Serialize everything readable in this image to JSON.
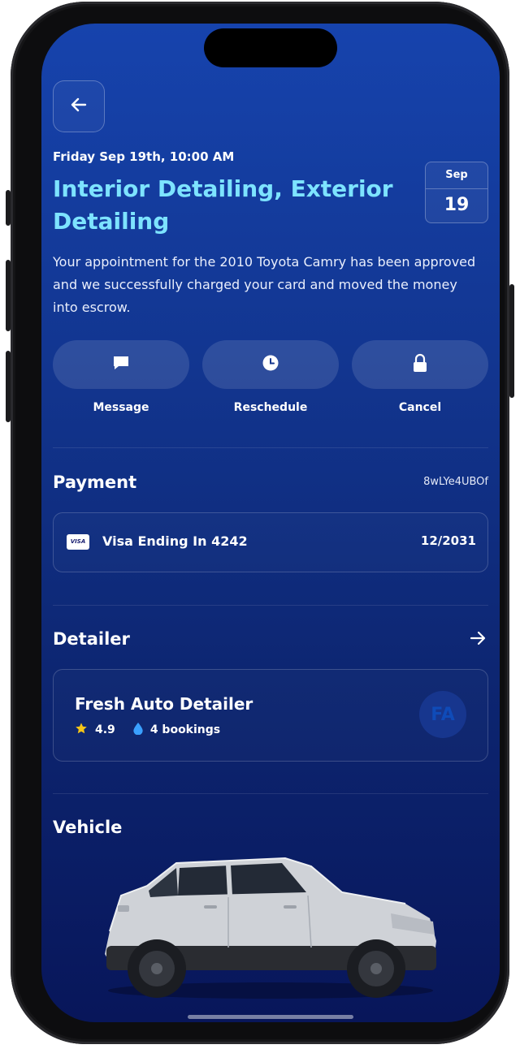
{
  "appointment": {
    "datetime": "Friday Sep 19th, 10:00 AM",
    "title": "Interior Detailing, Exterior Detailing",
    "calendar_month": "Sep",
    "calendar_day": "19",
    "description": "Your appointment for the 2010 Toyota Camry has been approved and we successfully charged your card and moved the money into escrow."
  },
  "actions": [
    {
      "label": "Message",
      "icon": "chat-icon"
    },
    {
      "label": "Reschedule",
      "icon": "clock-icon"
    },
    {
      "label": "Cancel",
      "icon": "lock-icon"
    }
  ],
  "payment": {
    "heading": "Payment",
    "transaction_id": "8wLYe4UBOf",
    "card_brand": "VISA",
    "card_label": "Visa Ending In 4242",
    "expiry": "12/2031"
  },
  "detailer": {
    "heading": "Detailer",
    "name": "Fresh Auto Detailer",
    "rating": "4.9",
    "bookings": "4 bookings",
    "initials": "FA"
  },
  "vehicle": {
    "heading": "Vehicle"
  },
  "colors": {
    "accent_title": "#7de3ff",
    "background_top": "#1643ad",
    "background_bottom": "#08165a",
    "star": "#f5c518",
    "drop": "#3aa0ff"
  }
}
